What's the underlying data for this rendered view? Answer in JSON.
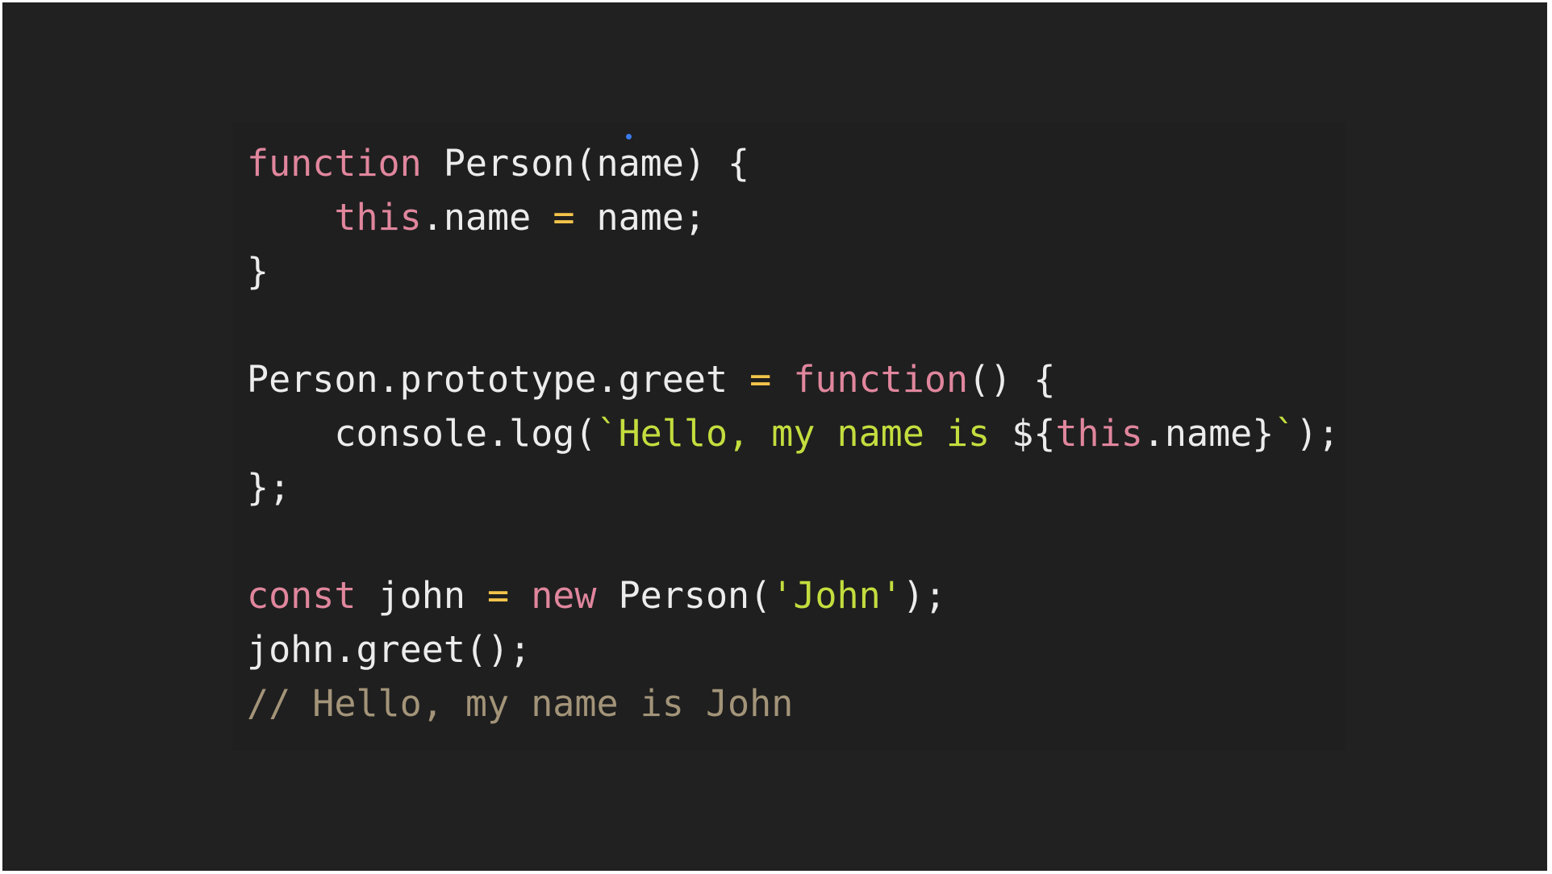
{
  "colors": {
    "background": "#212121",
    "keyword": "#e0869d",
    "operator": "#f3c34a",
    "string": "#c4dd3e",
    "comment": "#a39479",
    "plain": "#ececec",
    "cursor": "#3a7bf0"
  },
  "code": {
    "line1": {
      "kw": "function",
      "rest": " Person(name) {"
    },
    "line2": {
      "indent": "    ",
      "kw": "this",
      "a": ".name ",
      "op": "=",
      "b": " name;"
    },
    "line3": {
      "text": "}"
    },
    "line4": {
      "text": ""
    },
    "line5": {
      "a": "Person.prototype.greet ",
      "op": "=",
      "sp": " ",
      "kw": "function",
      "b": "() {"
    },
    "line6": {
      "indent": "    ",
      "a": "console.log(",
      "str": "`Hello, my name is ",
      "interp_open": "${",
      "kw": "this",
      "b": ".name",
      "interp_close": "}",
      "str_end": "`",
      "c": ");"
    },
    "line7": {
      "text": "};"
    },
    "line8": {
      "text": ""
    },
    "line9": {
      "kw1": "const",
      "a": " john ",
      "op": "=",
      "sp": " ",
      "kw2": "new",
      "b": " Person(",
      "str": "'John'",
      "c": ");"
    },
    "line10": {
      "text": "john.greet();"
    },
    "line11": {
      "comment": "// Hello, my name is John"
    }
  }
}
